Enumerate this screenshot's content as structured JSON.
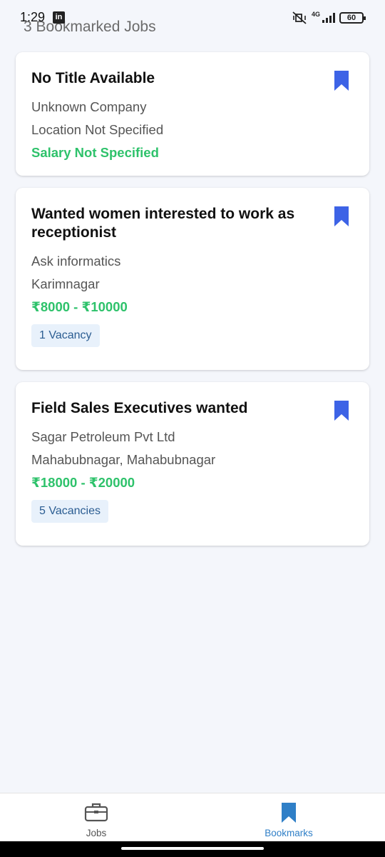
{
  "status_bar": {
    "time": "1:29",
    "network": "4G",
    "battery": "60",
    "linkedin_badge": "in"
  },
  "header": {
    "title": "3 Bookmarked Jobs"
  },
  "jobs": [
    {
      "title": "No Title Available",
      "company": "Unknown Company",
      "location": "Location Not Specified",
      "salary": "Salary Not Specified",
      "vacancy": ""
    },
    {
      "title": "Wanted women interested to work as receptionist",
      "company": "Ask informatics",
      "location": "Karimnagar",
      "salary": "₹8000 - ₹10000",
      "vacancy": "1 Vacancy"
    },
    {
      "title": "Field Sales Executives wanted",
      "company": "Sagar Petroleum Pvt Ltd",
      "location": "Mahabubnagar, Mahabubnagar",
      "salary": "₹18000 - ₹20000",
      "vacancy": "5 Vacancies"
    }
  ],
  "bottom_nav": {
    "items": [
      {
        "label": "Jobs",
        "icon": "briefcase-icon",
        "active": false
      },
      {
        "label": "Bookmarks",
        "icon": "bookmark-icon",
        "active": true
      }
    ]
  },
  "colors": {
    "bookmark": "#3d63e6",
    "salary": "#2ec26b",
    "active_tab": "#2f7fc7",
    "vacancy_bg": "#e8f1fb",
    "vacancy_text": "#2b5d92"
  }
}
